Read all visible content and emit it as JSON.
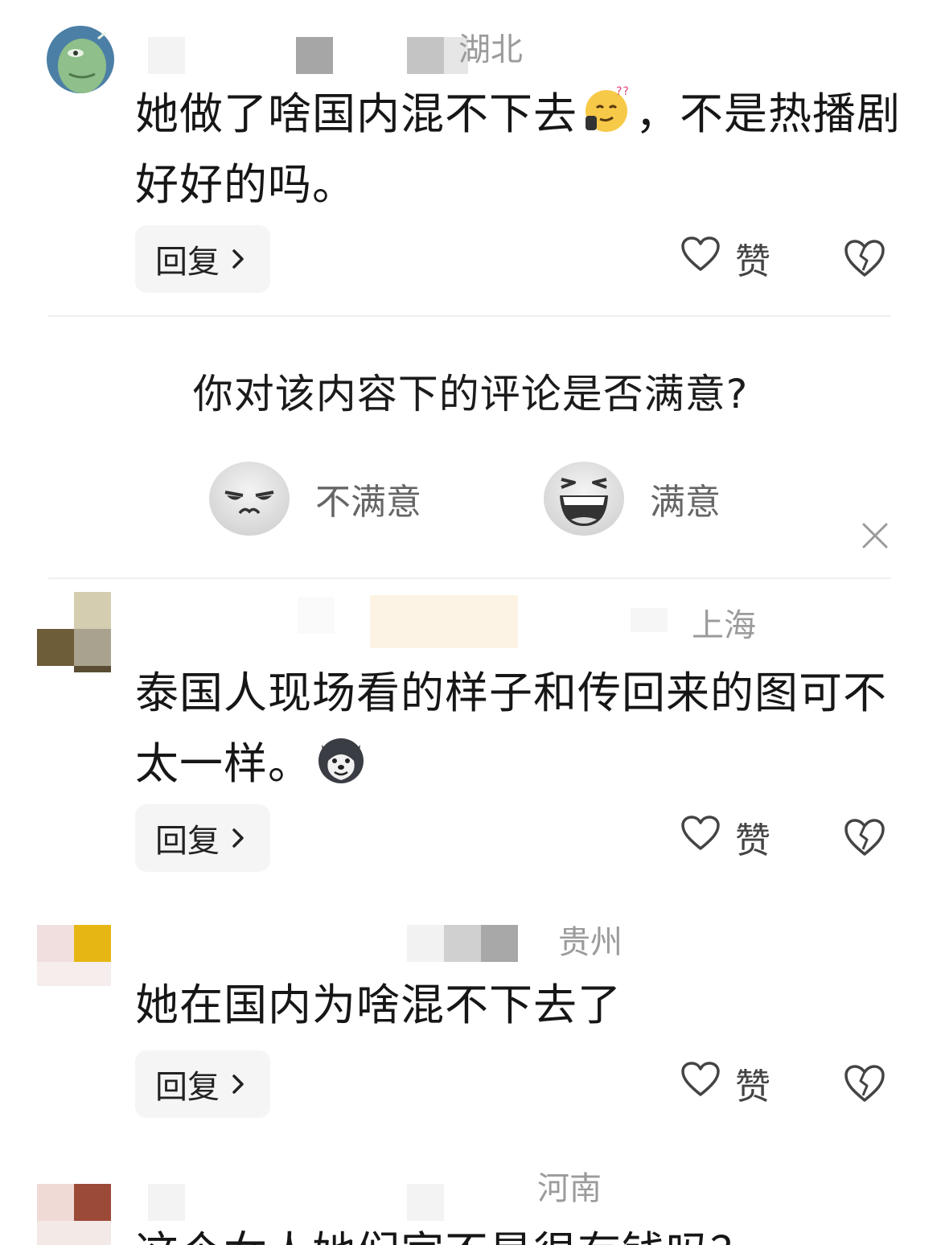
{
  "comments": [
    {
      "region": "湖北",
      "text": "她做了啥国内混不下去",
      "emoji_name": "thinking-emoji",
      "text_tail": "，不是热播剧好好的吗。",
      "reply_label": "回复",
      "like_label": "赞"
    },
    {
      "region": "上海",
      "text": "泰国人现场看的样子和传回来的图可不太一样。",
      "emoji_name": "husky-dog-emoji",
      "reply_label": "回复",
      "like_label": "赞"
    },
    {
      "region": "贵州",
      "text": "她在国内为啥混不下去了",
      "reply_label": "回复",
      "like_label": "赞"
    },
    {
      "region": "河南",
      "text": "这个女人她们家不是很有钱吗？"
    }
  ],
  "survey": {
    "question": "你对该内容下的评论是否满意?",
    "options": [
      {
        "label": "不满意",
        "icon": "unsatisfied-face-icon"
      },
      {
        "label": "满意",
        "icon": "satisfied-face-icon"
      }
    ]
  },
  "colors": {
    "region_text": "#9b9b9b",
    "reply_bg": "#f5f5f5",
    "divider": "#f0f0f0"
  }
}
